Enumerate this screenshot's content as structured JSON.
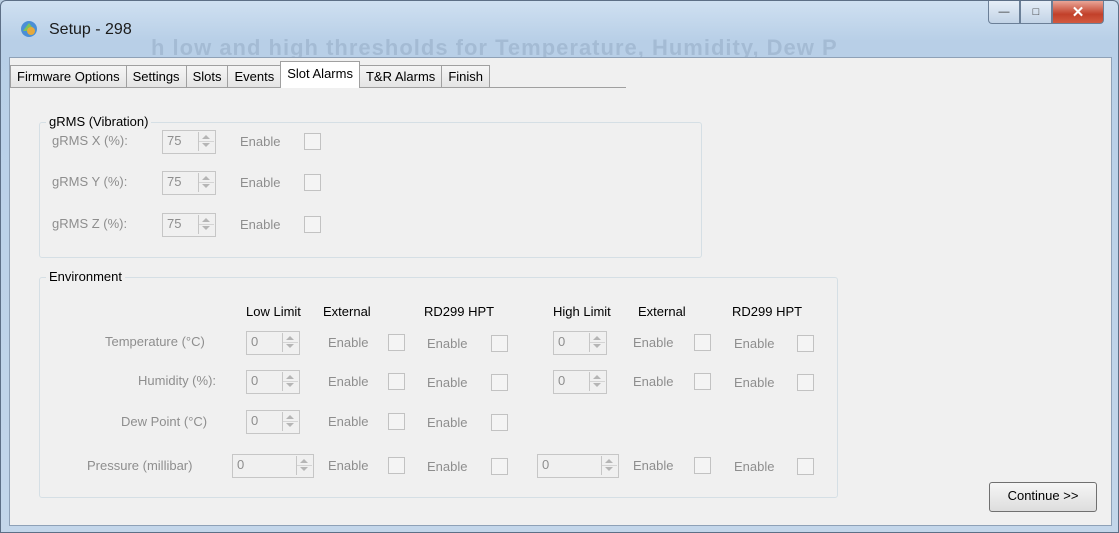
{
  "window": {
    "title": "Setup - 298",
    "ghost_text": "h low and high thresholds for Temperature, Humidity, Dew P"
  },
  "tabs": [
    "Firmware Options",
    "Settings",
    "Slots",
    "Events",
    "Slot Alarms",
    "T&R Alarms",
    "Finish"
  ],
  "active_tab": "Slot Alarms",
  "grms": {
    "title": "gRMS (Vibration)",
    "rows": [
      {
        "label": "gRMS X (%):",
        "value": "75",
        "enable_label": "Enable",
        "checked": false
      },
      {
        "label": "gRMS Y (%):",
        "value": "75",
        "enable_label": "Enable",
        "checked": false
      },
      {
        "label": "gRMS Z (%):",
        "value": "75",
        "enable_label": "Enable",
        "checked": false
      }
    ]
  },
  "environment": {
    "title": "Environment",
    "headers": {
      "low_limit": "Low Limit",
      "external_1": "External",
      "rd_1": "RD299 HPT",
      "high_limit": "High Limit",
      "external_2": "External",
      "rd_2": "RD299 HPT"
    },
    "rows": [
      {
        "label": "Temperature (°C)",
        "low": "0",
        "high": "0",
        "enable": "Enable"
      },
      {
        "label": "Humidity (%):",
        "low": "0",
        "high": "0",
        "enable": "Enable"
      },
      {
        "label": "Dew Point (°C)",
        "low": "0",
        "enable": "Enable"
      },
      {
        "label": "Pressure (millibar)",
        "low": "0",
        "high": "0",
        "enable": "Enable"
      }
    ]
  },
  "continue_label": "Continue >>"
}
